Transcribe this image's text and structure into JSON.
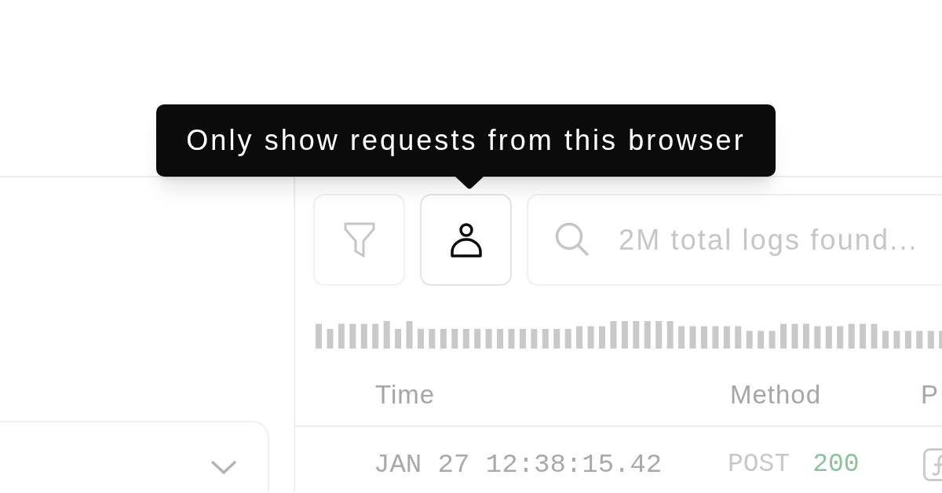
{
  "tooltip": {
    "text": "Only show requests from this browser"
  },
  "left_panel": {
    "dropdown": {
      "expanded": false
    }
  },
  "toolbar": {
    "buttons": [
      {
        "kind": "filter",
        "active": false
      },
      {
        "kind": "user",
        "active": true
      }
    ],
    "search": {
      "placeholder": "2M total logs found..."
    }
  },
  "table": {
    "columns": [
      "Time",
      "Method",
      "P"
    ],
    "rows": [
      {
        "time": "JAN 27 12:38:15.42",
        "method": "POST",
        "status": "200"
      }
    ]
  }
}
